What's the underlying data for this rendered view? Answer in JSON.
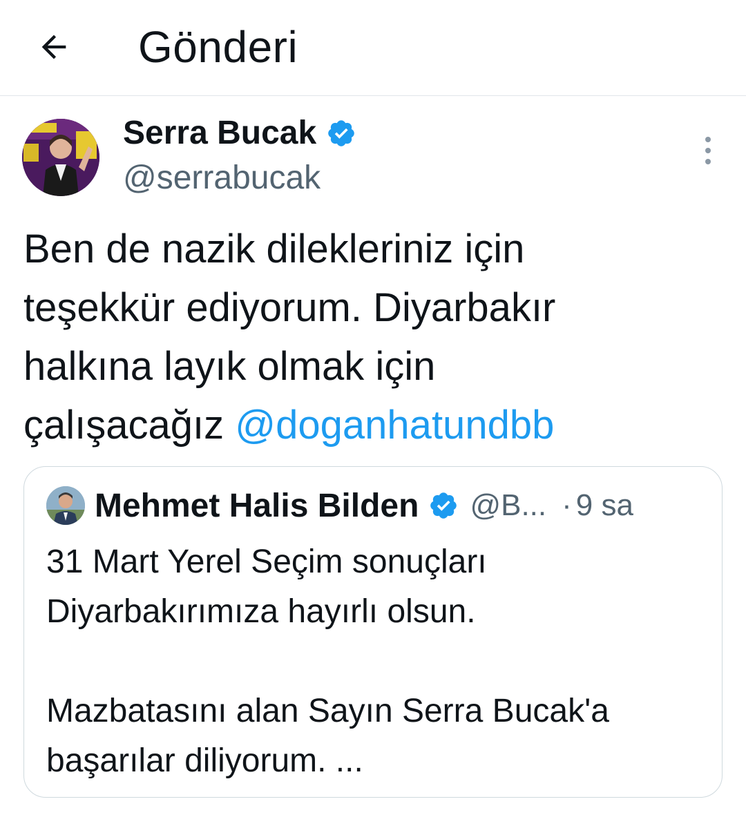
{
  "header": {
    "title": "Gönderi",
    "back_icon": "arrow-left-icon"
  },
  "tweet": {
    "author": {
      "name": "Serra Bucak",
      "handle": "@serrabucak",
      "verified": true
    },
    "text_lines": [
      "Ben de nazik dilekleriniz için",
      "teşekkür ediyorum. Diyarbakır",
      "halkına layık olmak için",
      "çalışacağız "
    ],
    "mention": "@doganhatundbb",
    "more_icon": "more-vertical-icon"
  },
  "quoted": {
    "author": {
      "name": "Mehmet Halis Bilden",
      "handle": "@B...",
      "verified": true
    },
    "separator": "·",
    "time": "9 sa",
    "paragraph1": [
      "31 Mart Yerel Seçim sonuçları",
      "Diyarbakırımıza hayırlı olsun."
    ],
    "paragraph2": [
      "Mazbatasını alan Sayın Serra Bucak'a",
      "başarılar diliyorum. ..."
    ]
  },
  "colors": {
    "text": "#0f1419",
    "secondary": "#536471",
    "link": "#1d9bf0",
    "verified": "#1d9bf0",
    "divider": "#e1e6ea",
    "border": "#cfd9de"
  }
}
